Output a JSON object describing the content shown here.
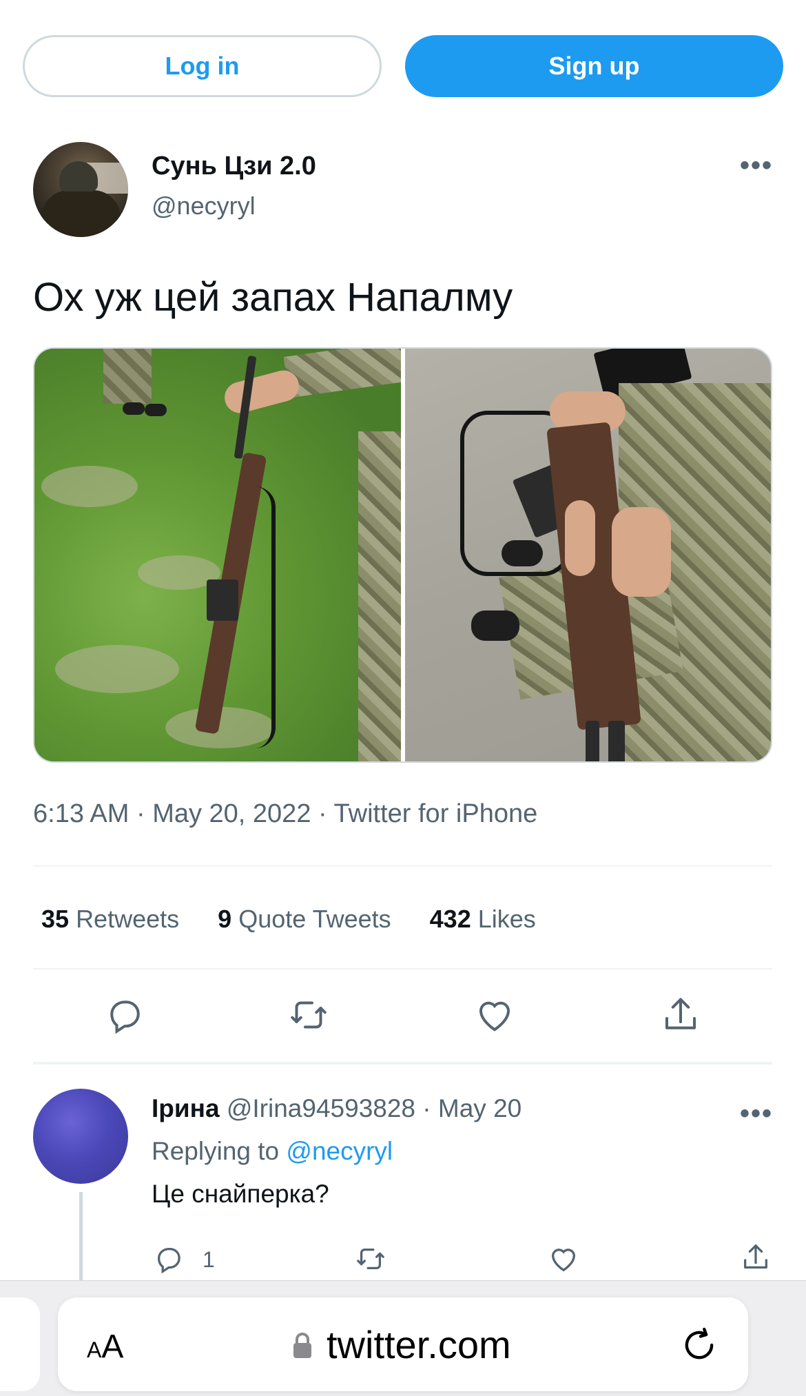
{
  "auth": {
    "login_label": "Log in",
    "signup_label": "Sign up"
  },
  "tweet": {
    "author_name": "Сунь Цзи 2.0",
    "author_handle": "@necyryl",
    "text": "Ох уж цей запах Напалму",
    "meta": "6:13 AM · May 20, 2022 · Twitter for iPhone",
    "stats": {
      "retweets_count": "35",
      "retweets_label": "Retweets",
      "quotes_count": "9",
      "quotes_label": "Quote Tweets",
      "likes_count": "432",
      "likes_label": "Likes"
    },
    "more_icon": "ellipsis-icon"
  },
  "reply": {
    "name": "Ірина",
    "handle": "@Irina94593828",
    "date": "May 20",
    "replying_prefix": "Replying to",
    "replying_handle": "@necyryl",
    "text": "Це снайперка?",
    "reply_count": "1"
  },
  "browser": {
    "aa_label_small": "A",
    "aa_label_large": "A",
    "url": "twitter.com"
  },
  "colors": {
    "accent": "#1d9bf0",
    "secondary_text": "#536471",
    "divider": "#eff3f4"
  }
}
